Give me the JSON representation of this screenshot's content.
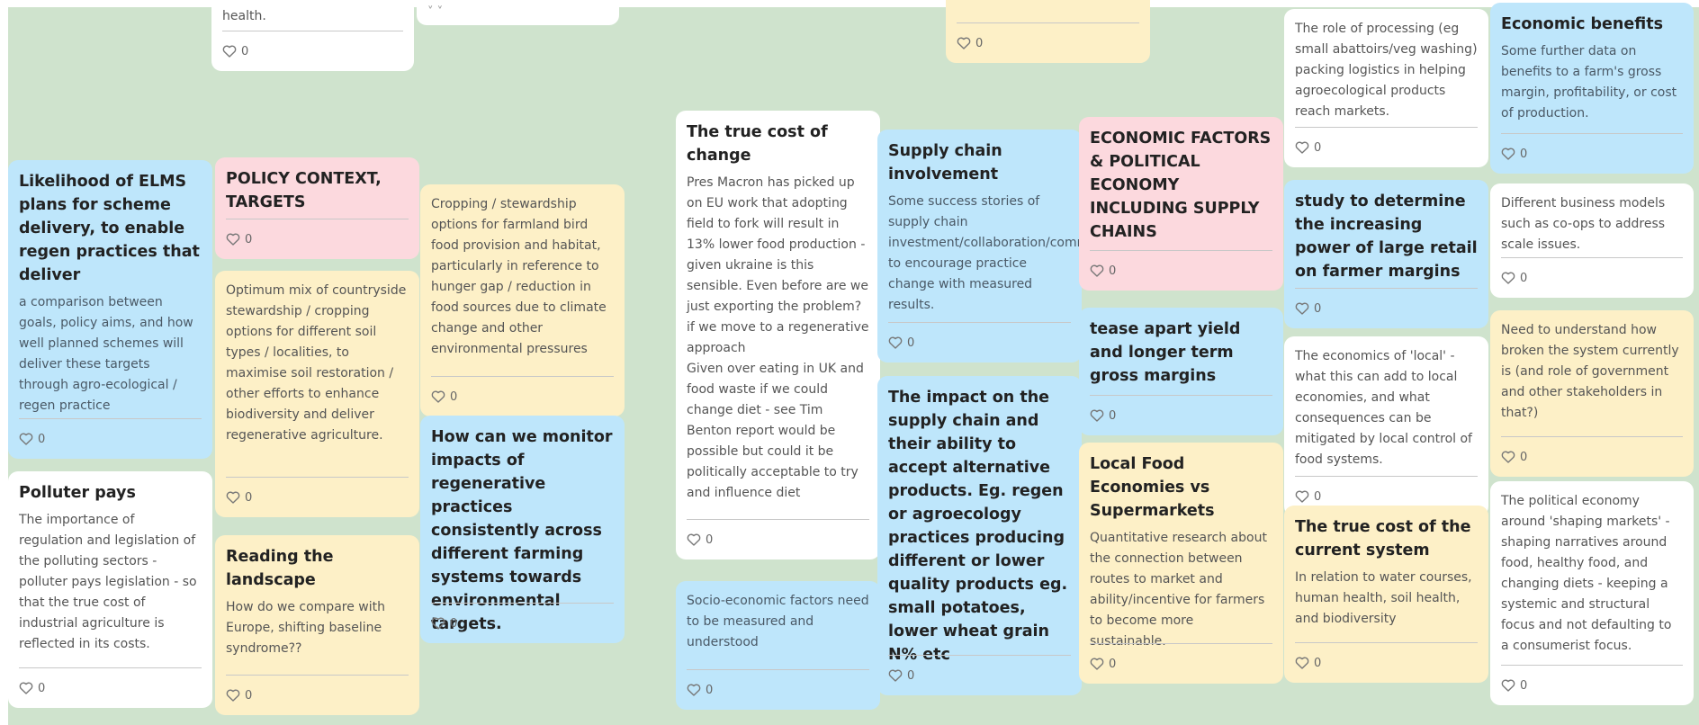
{
  "board": {
    "background": "#cfe3cd"
  },
  "colors": {
    "blue": "#bee6fb",
    "yellow": "#fdf0c7",
    "pink": "#fcd9de",
    "white": "#ffffff"
  },
  "cards": {
    "health_partial": {
      "body": "health.",
      "likes": "0"
    },
    "chevrons_partial": {
      "glyph": "˅ ˅"
    },
    "yellow_partial": {
      "likes": "0"
    },
    "processing": {
      "body": "The role of processing (eg small abattoirs/veg washing) packing logistics in helping agroecological products reach markets.",
      "likes": "0"
    },
    "economic_benefits": {
      "title": "Economic benefits",
      "body": "Some further data on benefits to a farm's gross margin, profitability, or cost of production.",
      "likes": "0"
    },
    "true_cost_change": {
      "title": "The true cost of change",
      "body": "Pres Macron has picked up on EU work that adopting field to fork will result in 13% lower food production - given ukraine is this sensible. Even before are we just exporting the problem? if we move to a regenerative approach\nGiven over eating in UK and food waste if we could change diet - see Tim Benton report would be possible but could it be politically acceptable to try and influence diet",
      "likes": "0"
    },
    "supply_chain": {
      "title": "Supply chain involvement",
      "body": "Some success stories of supply chain investment/collaboration/commitment to encourage practice change with measured results.",
      "likes": "0"
    },
    "economic_factors": {
      "title": "ECONOMIC FACTORS & POLITICAL ECONOMY INCLUDING SUPPLY CHAINS",
      "likes": "0"
    },
    "elms": {
      "title": "Likelihood of ELMS plans for scheme delivery, to enable regen practices that deliver",
      "body": "a comparison between goals, policy aims, and how well planned schemes will deliver these targets through agro-ecological / regen practice",
      "likes": "0"
    },
    "policy_context": {
      "title": "POLICY CONTEXT, TARGETS",
      "likes": "0"
    },
    "cropping": {
      "body": "Cropping / stewardship options for farmland bird food provision and habitat, particularly in reference to hunger gap / reduction in food sources due to climate change and other environmental pressures",
      "likes": "0"
    },
    "retail_power": {
      "title": "study to determine the increasing power of large retail on farmer margins",
      "likes": "0"
    },
    "business_models": {
      "body": "Different business models such as co-ops to address scale issues.",
      "likes": "0"
    },
    "optimum_mix": {
      "body": "Optimum mix of countryside stewardship / cropping options for different soil types / localities, to maximise soil restoration / other efforts to enhance biodiversity and deliver regenerative agriculture.",
      "likes": "0"
    },
    "tease_apart": {
      "title": "tease apart yield and longer term gross margins",
      "likes": "0"
    },
    "broken_system": {
      "body": "Need to understand how broken the system currently is (and role of government and other stakeholders in that?)",
      "likes": "0"
    },
    "local_economics": {
      "body": "The economics of 'local' - what this can add to local economies, and what consequences can be mitigated by local control of food systems.",
      "likes": "0"
    },
    "impact_supply": {
      "title": "The impact on the supply chain and their ability to accept alternative products. Eg. regen or agroecology practices producing different or lower quality products eg. small potatoes, lower wheat grain N% etc",
      "likes": "0"
    },
    "monitor": {
      "title": "How can we monitor impacts of regenerative practices consistently across different farming systems towards environmental targets.",
      "likes": "0"
    },
    "local_food": {
      "title": "Local Food Economies vs Supermarkets",
      "body": "Quantitative research about the connection between routes to market and ability/incentive for farmers to become more sustainable.",
      "likes": "0"
    },
    "polluter_pays": {
      "title": "Polluter pays",
      "body": "The importance of regulation and legislation of the polluting sectors - polluter pays legislation - so that the true cost of industrial agriculture is reflected in its costs.",
      "likes": "0"
    },
    "true_cost_current": {
      "title": "The true cost of the current system",
      "body": "In relation to water courses, human health, soil health, and biodiversity",
      "likes": "0"
    },
    "political_economy": {
      "body": "The political economy around 'shaping markets' - shaping narratives around food, healthy food, and changing diets - keeping a systemic and structural focus and not defaulting to a consumerist focus.",
      "likes": "0"
    },
    "reading_landscape": {
      "title": "Reading the landscape",
      "body": "How do we compare with Europe, shifting baseline syndrome??",
      "likes": "0"
    },
    "socio_economic": {
      "body": "Socio-economic factors need to be measured and understood",
      "likes": "0"
    }
  },
  "icons": {
    "like": "heart-outline-icon"
  }
}
